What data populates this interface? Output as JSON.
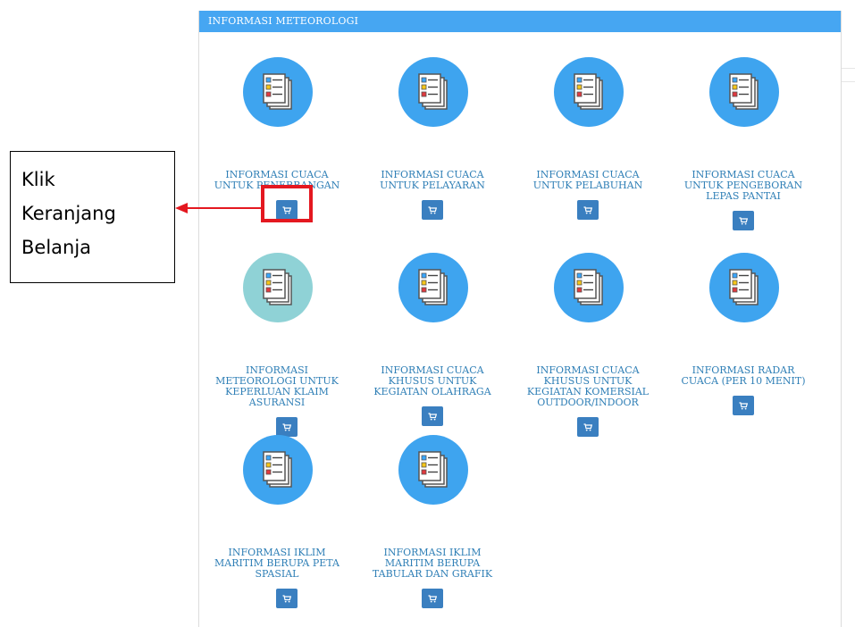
{
  "panel": {
    "title": "INFORMASI METEOROLOGI"
  },
  "items": [
    {
      "title": [
        "INFORMASI CUACA",
        "UNTUK PENERBANGAN"
      ],
      "icon": "document-list-icon",
      "variant": "blue"
    },
    {
      "title": [
        "INFORMASI CUACA",
        "UNTUK PELAYARAN"
      ],
      "icon": "document-list-icon",
      "variant": "blue"
    },
    {
      "title": [
        "INFORMASI CUACA",
        "UNTUK PELABUHAN"
      ],
      "icon": "document-list-icon",
      "variant": "blue"
    },
    {
      "title": [
        "INFORMASI CUACA",
        "UNTUK PENGEBORAN",
        "LEPAS PANTAI"
      ],
      "icon": "document-list-icon",
      "variant": "blue"
    },
    {
      "title": [
        "INFORMASI",
        "METEOROLOGI UNTUK",
        "KEPERLUAN KLAIM",
        "ASURANSI"
      ],
      "icon": "document-list-icon",
      "variant": "teal"
    },
    {
      "title": [
        "INFORMASI CUACA",
        "KHUSUS UNTUK",
        "KEGIATAN OLAHRAGA"
      ],
      "icon": "document-list-icon",
      "variant": "blue"
    },
    {
      "title": [
        "INFORMASI CUACA",
        "KHUSUS UNTUK",
        "KEGIATAN KOMERSIAL",
        "OUTDOOR/INDOOR"
      ],
      "icon": "document-list-icon",
      "variant": "blue"
    },
    {
      "title": [
        "INFORMASI RADAR",
        "CUACA (PER 10 MENIT)"
      ],
      "icon": "document-list-icon",
      "variant": "blue"
    },
    {
      "title": [
        "INFORMASI IKLIM",
        "MARITIM BERUPA PETA",
        "SPASIAL"
      ],
      "icon": "document-list-icon",
      "variant": "blue"
    },
    {
      "title": [
        "INFORMASI IKLIM",
        "MARITIM BERUPA",
        "TABULAR DAN GRAFIK"
      ],
      "icon": "document-list-icon",
      "variant": "blue"
    }
  ],
  "cart_icon": "shopping-cart-icon",
  "annotation": {
    "lines": [
      "Klik",
      "Keranjang",
      "Belanja"
    ],
    "highlight_color": "#e41820"
  },
  "colors": {
    "header": "#46a6f2",
    "circle": "#3ea4ef",
    "circle_alt": "#8fd2d6",
    "title_text": "#2f7fb6",
    "cart_button": "#3a7fc0"
  }
}
